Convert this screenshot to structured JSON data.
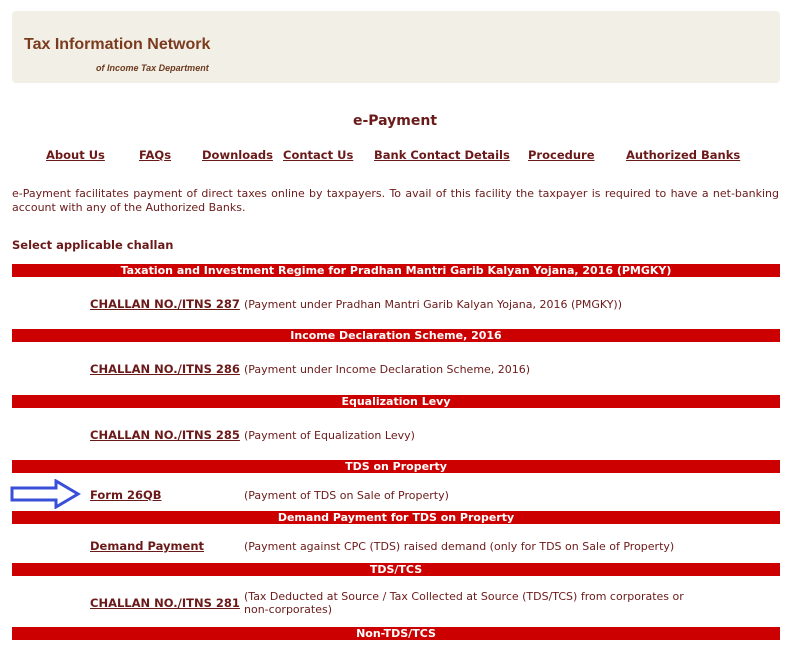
{
  "header": {
    "title": "Tax Information Network",
    "subtitle": "of Income Tax Department"
  },
  "page_title": "e-Payment",
  "nav": {
    "about": "About Us",
    "faqs": "FAQs",
    "downloads": "Downloads",
    "contact": "Contact Us",
    "bank_contact": "Bank Contact Details",
    "procedure": "Procedure",
    "banks": "Authorized Banks"
  },
  "intro": "e-Payment facilitates payment of direct taxes online by taxpayers. To avail of this facility the taxpayer is required to have a net-banking account with any of the Authorized Banks.",
  "select_label": "Select applicable challan",
  "sections": [
    {
      "heading": "Taxation and Investment Regime for Pradhan Mantri Garib Kalyan Yojana, 2016 (PMGKY)",
      "link": "CHALLAN NO./ITNS 287",
      "desc": "(Payment under Pradhan Mantri Garib Kalyan Yojana, 2016 (PMGKY))"
    },
    {
      "heading": "Income Declaration Scheme, 2016",
      "link": "CHALLAN NO./ITNS 286",
      "desc": "(Payment under Income Declaration Scheme, 2016)"
    },
    {
      "heading": "Equalization Levy",
      "link": "CHALLAN NO./ITNS 285",
      "desc": "(Payment of Equalization Levy)"
    },
    {
      "heading": "TDS on Property",
      "link": "Form 26QB",
      "desc": "(Payment of TDS on Sale of Property)"
    },
    {
      "heading": "Demand Payment for TDS on Property",
      "link": "Demand Payment",
      "desc": "(Payment against CPC (TDS) raised demand (only for TDS on Sale of Property)"
    },
    {
      "heading": "TDS/TCS",
      "link": "CHALLAN NO./ITNS 281",
      "desc": "(Tax Deducted at Source / Tax Collected at Source (TDS/TCS) from corporates or non-corporates)"
    },
    {
      "heading": "Non-TDS/TCS"
    }
  ],
  "icons": {
    "pointer": "right-arrow-icon"
  },
  "colors": {
    "bar": "#cc0000",
    "text": "#6b1a1a",
    "header_bg": "#f2efe6",
    "arrow": "#3a4fd8"
  }
}
